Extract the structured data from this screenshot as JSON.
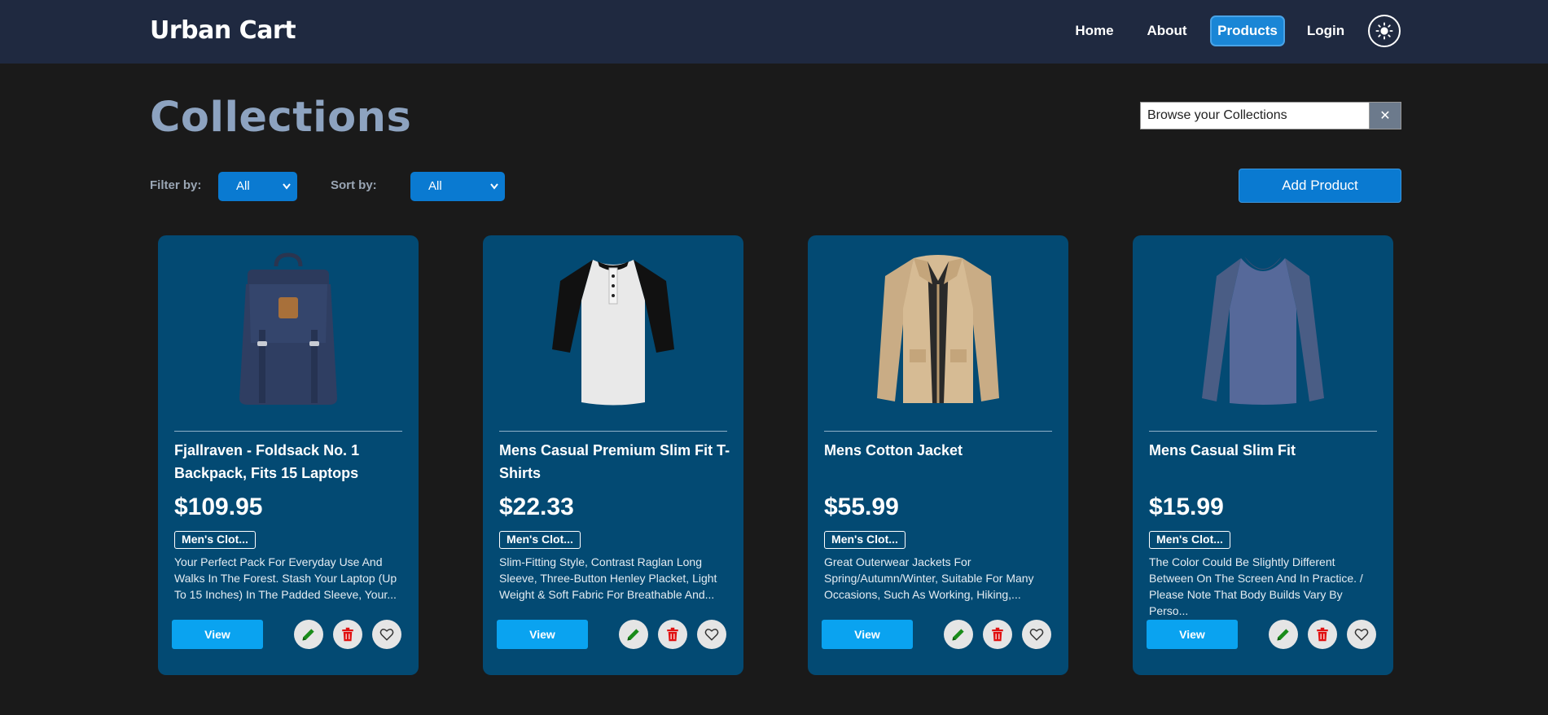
{
  "navbar": {
    "brand": "Urban Cart",
    "links": [
      {
        "label": "Home"
      },
      {
        "label": "About"
      },
      {
        "label": "Products"
      },
      {
        "label": "Login"
      }
    ],
    "active": "Products",
    "theme_icon": "sun-icon"
  },
  "header": {
    "title": "Collections",
    "search_value": "Browse your Collections",
    "clear_label": "✕"
  },
  "controls": {
    "filter_label": "Filter by:",
    "filter_value": "All",
    "sort_label": "Sort by:",
    "sort_value": "All",
    "add_label": "Add Product"
  },
  "products": [
    {
      "title": "Fjallraven - Foldsack No. 1 Backpack, Fits 15 Laptops",
      "price": "$109.95",
      "category": "Men's Clot...",
      "description": "Your Perfect Pack For Everyday Use And Walks In The Forest. Stash Your Laptop (Up To 15 Inches) In The Padded Sleeve, Your...",
      "view_label": "View",
      "image": "backpack"
    },
    {
      "title": "Mens Casual Premium Slim Fit T-Shirts",
      "price": "$22.33",
      "category": "Men's Clot...",
      "description": "Slim-Fitting Style, Contrast Raglan Long Sleeve, Three-Button Henley Placket, Light Weight & Soft Fabric For Breathable And...",
      "view_label": "View",
      "image": "raglan-shirt"
    },
    {
      "title": "Mens Cotton Jacket",
      "price": "$55.99",
      "category": "Men's Clot...",
      "description": "Great Outerwear Jackets For Spring/Autumn/Winter, Suitable For Many Occasions, Such As Working, Hiking,...",
      "view_label": "View",
      "image": "jacket"
    },
    {
      "title": "Mens Casual Slim Fit",
      "price": "$15.99",
      "category": "Men's Clot...",
      "description": "The Color Could Be Slightly Different Between On The Screen And In Practice. / Please Note That Body Builds Vary By Perso...",
      "view_label": "View",
      "image": "long-sleeve-shirt"
    }
  ],
  "colors": {
    "nav_bg": "#1f2940",
    "page_bg": "#1a1a1a",
    "card_bg": "#034a73",
    "accent": "#0a7ad1",
    "view_btn": "#0aa3f0",
    "edit_icon": "#1a8c1a",
    "delete_icon": "#e01010"
  }
}
